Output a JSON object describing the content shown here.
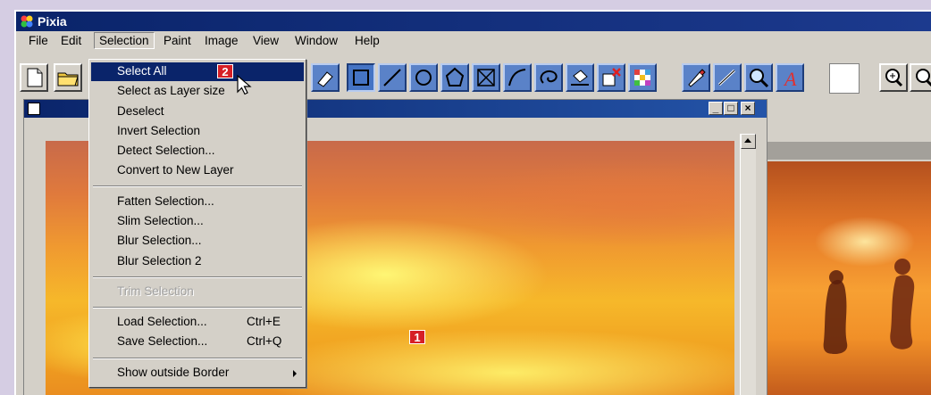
{
  "app": {
    "title": "Pixia"
  },
  "menubar": [
    "File",
    "Edit",
    "Selection",
    "Paint",
    "Image",
    "View",
    "Window",
    "Help"
  ],
  "active_menu": "Selection",
  "selection_menu": {
    "items": [
      {
        "label": "Select All",
        "highlighted": true
      },
      {
        "label": "Select as Layer size"
      },
      {
        "label": "Deselect"
      },
      {
        "label": "Invert Selection"
      },
      {
        "label": "Detect Selection..."
      },
      {
        "label": "Convert to New Layer"
      },
      {
        "label": "Fatten Selection..."
      },
      {
        "label": "Slim Selection..."
      },
      {
        "label": "Blur Selection..."
      },
      {
        "label": "Blur Selection 2"
      },
      {
        "label": "Trim Selection",
        "disabled": true
      },
      {
        "label": "Load Selection...",
        "shortcut": "Ctrl+E"
      },
      {
        "label": "Save Selection...",
        "shortcut": "Ctrl+Q"
      },
      {
        "label": "Show outside Border",
        "submenu": true
      }
    ]
  },
  "callouts": {
    "one": "1",
    "two": "2"
  },
  "icons": [
    "new-file-icon",
    "open-folder-icon",
    "eraser-icon",
    "rectangle-icon",
    "line-icon",
    "ellipse-icon",
    "polygon-icon",
    "cross-icon",
    "curve-icon",
    "lasso-icon",
    "fill-bucket-icon",
    "delete-layer-icon",
    "pattern-icon",
    "paint-brush-icon",
    "smudge-icon",
    "zoom-icon",
    "text-icon",
    "magnifier-icon"
  ],
  "colors": {
    "titlebar": "#0a246a",
    "highlight": "#0a246a",
    "callout": "#d61f26",
    "tool_blue": "#5a82c8"
  }
}
